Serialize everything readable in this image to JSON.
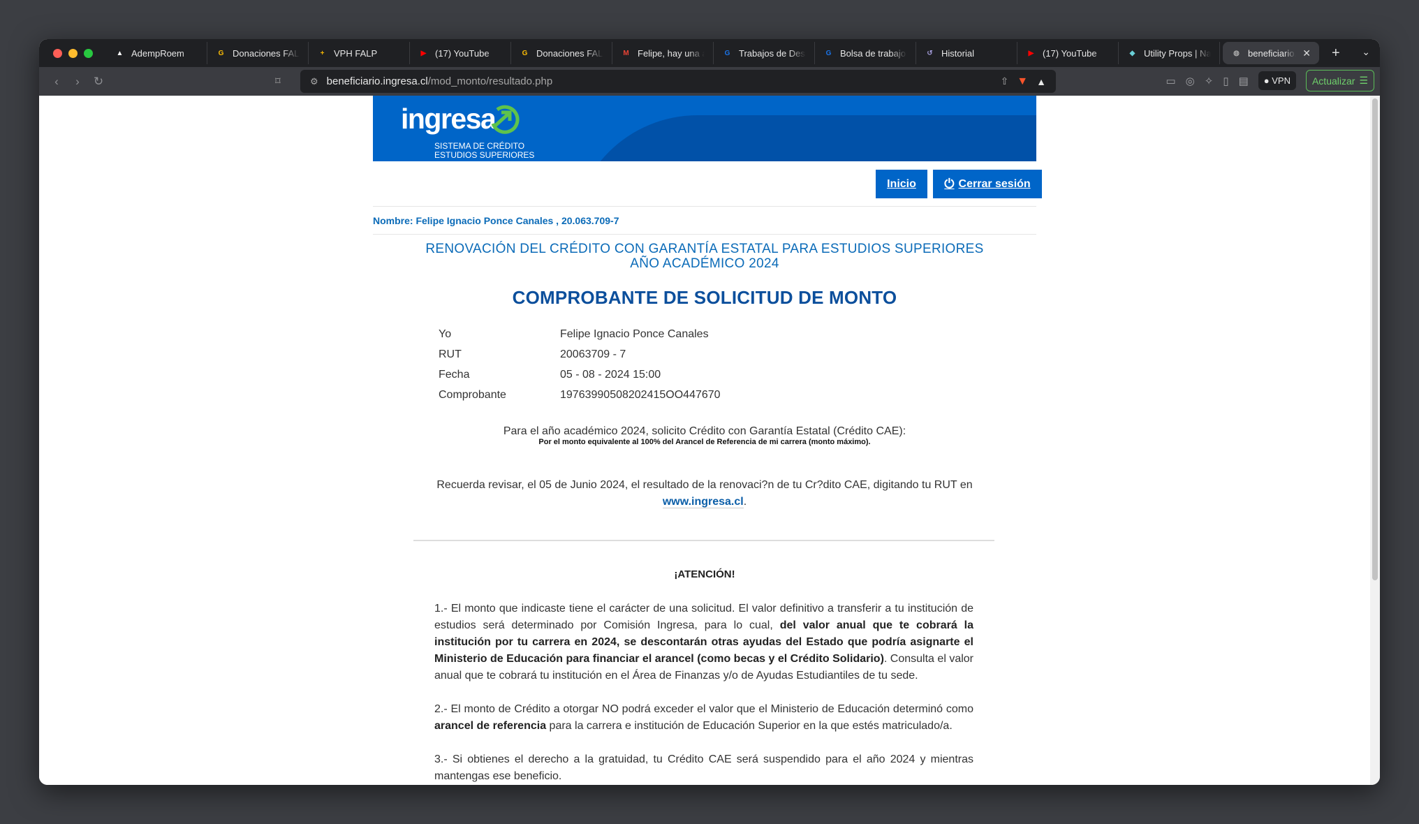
{
  "browser": {
    "tabs": [
      {
        "label": "AdempRoem",
        "icon": "triangle-icon",
        "color": "#ffffff"
      },
      {
        "label": "Donaciones FALP",
        "icon": "google-icon",
        "color": "#fbbc05"
      },
      {
        "label": "VPH FALP",
        "icon": "docs-icon",
        "color": "#f4b400"
      },
      {
        "label": "(17) YouTube",
        "icon": "youtube-icon",
        "color": "#ff0000"
      },
      {
        "label": "Donaciones FALP",
        "icon": "google-icon",
        "color": "#fbbc05"
      },
      {
        "label": "Felipe, hay una a",
        "icon": "gmail-icon",
        "color": "#ea4335"
      },
      {
        "label": "Trabajos de Desa",
        "icon": "g-icon",
        "color": "#1a73e8"
      },
      {
        "label": "Bolsa de trabajo",
        "icon": "g-icon",
        "color": "#1a73e8"
      },
      {
        "label": "Historial",
        "icon": "history-icon",
        "color": "#a29bd8"
      },
      {
        "label": "(17) YouTube",
        "icon": "youtube-icon",
        "color": "#ff0000"
      },
      {
        "label": "Utility Props | Na",
        "icon": "cube-icon",
        "color": "#6ad0d8"
      },
      {
        "label": "beneficiario.ingresa.cl",
        "icon": "globe-icon",
        "color": "#aaaaaa",
        "active": true
      }
    ],
    "url_domain": "beneficiario.ingresa.cl",
    "url_path": "/mod_monto/resultado.php",
    "vpn_label": "VPN",
    "update_label": "Actualizar"
  },
  "header": {
    "logo_word": "ingresa",
    "logo_sub1": "SISTEMA DE CRÉDITO",
    "logo_sub2": "ESTUDIOS SUPERIORES",
    "inicio": "Inicio",
    "cerrar": "Cerrar sesión"
  },
  "nombre": "Nombre: Felipe Ignacio Ponce Canales , 20.063.709-7",
  "title1": "RENOVACIÓN DEL CRÉDITO CON GARANTÍA ESTATAL PARA ESTUDIOS SUPERIORES",
  "title2": "AÑO ACADÉMICO 2024",
  "comprobante_title": "COMPROBANTE DE SOLICITUD DE MONTO",
  "info": [
    {
      "label": "Yo",
      "value": "Felipe Ignacio Ponce Canales"
    },
    {
      "label": "RUT",
      "value": "20063709 - 7"
    },
    {
      "label": "Fecha",
      "value": "05 - 08 - 2024 15:00"
    },
    {
      "label": "Comprobante",
      "value": "19763990508202415OO447670"
    }
  ],
  "solicito": "Para el año académico 2024, solicito Crédito con Garantía Estatal (Crédito CAE):",
  "solicito_small": "Por el monto equivalente al 100% del Arancel de Referencia de mi carrera (monto máximo).",
  "recuerda": "Recuerda revisar, el 05 de Junio 2024, el resultado de la renovaci?n de tu Cr?dito CAE, digitando tu RUT en",
  "link": "www.ingresa.cl",
  "link_dot": ".",
  "atencion": "¡ATENCIÓN!",
  "t1a": "1.- El monto que indicaste tiene el carácter de una solicitud. El valor definitivo a transferir a tu institución de estudios será determinado por Comisión Ingresa, para lo cual, ",
  "t1b": "del valor anual que te cobrará la institución por tu carrera en 2024, se descontarán otras ayudas del Estado que podría asignarte el Ministerio de Educación para financiar el arancel (como becas y el Crédito Solidario)",
  "t1c": ". Consulta el valor anual que te cobrará tu institución en el Área de Finanzas y/o de Ayudas Estudiantiles de tu sede.",
  "t2a": "2.- El monto de Crédito a otorgar NO podrá exceder el valor que el Ministerio de Educación determinó como ",
  "t2b": "arancel de referencia",
  "t2c": " para la carrera e institución de Educación Superior en la que estés matriculado/a.",
  "t3": "3.- Si obtienes el derecho a la gratuidad, tu Crédito CAE será suspendido para el año 2024 y mientras mantengas ese beneficio."
}
